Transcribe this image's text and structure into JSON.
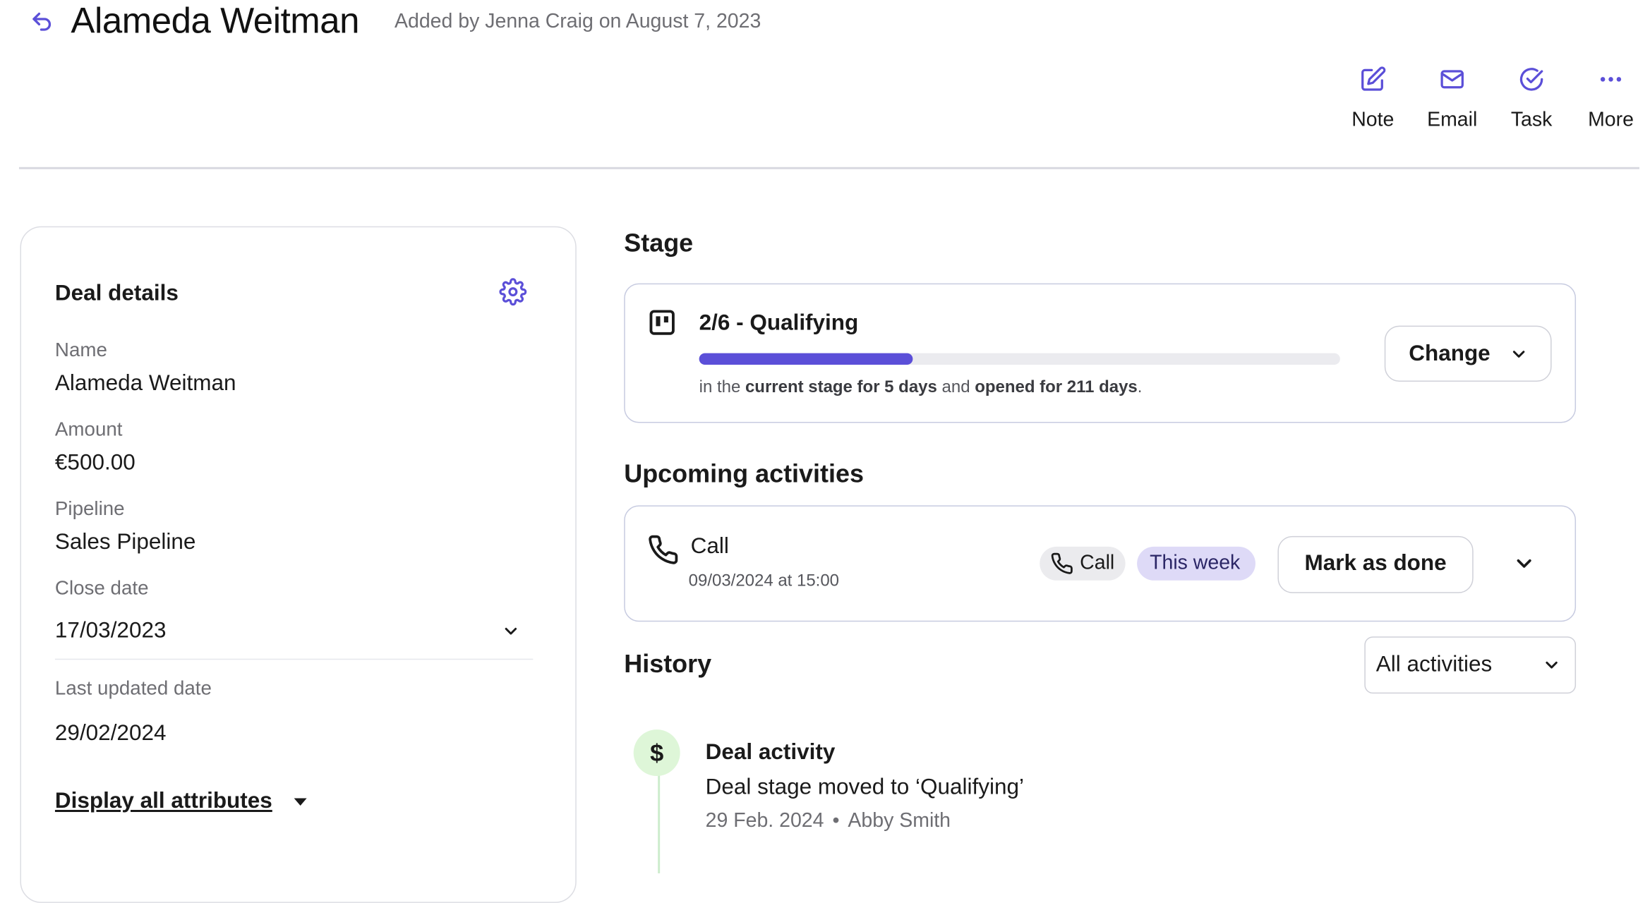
{
  "header": {
    "title": "Alameda Weitman",
    "subtitle": "Added by Jenna Craig on August 7, 2023",
    "actions": [
      {
        "label": "Note",
        "icon": "edit-icon"
      },
      {
        "label": "Email",
        "icon": "mail-icon"
      },
      {
        "label": "Task",
        "icon": "check-circle-icon"
      },
      {
        "label": "More",
        "icon": "more-icon"
      }
    ]
  },
  "deal_details": {
    "title": "Deal details",
    "fields": [
      {
        "label": "Name",
        "value": "Alameda Weitman"
      },
      {
        "label": "Amount",
        "value": "€500.00"
      },
      {
        "label": "Pipeline",
        "value": "Sales Pipeline"
      },
      {
        "label": "Close date",
        "value": "17/03/2023"
      },
      {
        "label": "Last updated date",
        "value": "29/02/2024"
      }
    ],
    "display_all_label": "Display all attributes"
  },
  "stage": {
    "heading": "Stage",
    "name": "2/6 - Qualifying",
    "progress_fraction": 0.333,
    "info_prefix": "in the",
    "info_current": "current stage for 5 days",
    "info_and": "and",
    "info_opened": "opened for 211 days",
    "info_suffix": ".",
    "change_label": "Change"
  },
  "upcoming": {
    "heading": "Upcoming activities",
    "activity": {
      "title": "Call",
      "datetime": "09/03/2024 at 15:00",
      "type_chip": "Call",
      "due_chip": "This week",
      "done_label": "Mark as done"
    }
  },
  "history": {
    "heading": "History",
    "filter_label": "All activities",
    "item": {
      "icon_glyph": "$",
      "title": "Deal activity",
      "description": "Deal stage moved to ‘Qualifying’",
      "date": "29 Feb. 2024",
      "separator": "•",
      "author": "Abby Smith"
    }
  },
  "colors": {
    "accent": "#5b4fd8",
    "chip_week_bg": "#dedaf7",
    "history_icon_bg": "#def6d8"
  }
}
